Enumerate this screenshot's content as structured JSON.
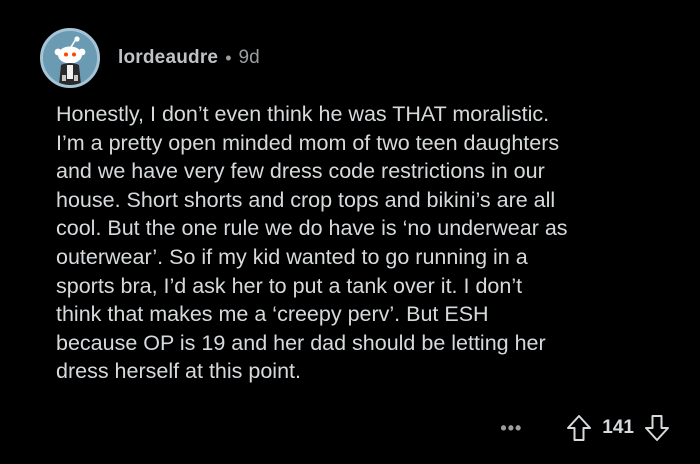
{
  "comment": {
    "author": "lordeaudre",
    "separator": "•",
    "age": "9d",
    "body": "Honestly, I don’t even think he was THAT moralistic.\nI’m a pretty open minded mom of two teen daughters\nand we have very few dress code restrictions in our\nhouse. Short shorts and crop tops and bikini’s are all\ncool. But the one rule we do have is ‘no underwear as\nouterwear’. So if my kid wanted to go running in a\nsports bra, I’d ask her to put a tank over it. I don’t\nthink that makes me a ‘creepy perv’. But ESH\nbecause OP is 19 and her dad should be letting her\ndress herself at this point.",
    "more_label": "•••",
    "score": "141"
  },
  "icons": {
    "avatar": "snoo-avatar",
    "upvote": "upvote-arrow-icon",
    "downvote": "downvote-arrow-icon",
    "more": "more-options-icon"
  },
  "colors": {
    "background": "#000000",
    "text": "#d7dadc",
    "meta": "#9a9da0",
    "avatar_ring": "#a7c3d6"
  }
}
